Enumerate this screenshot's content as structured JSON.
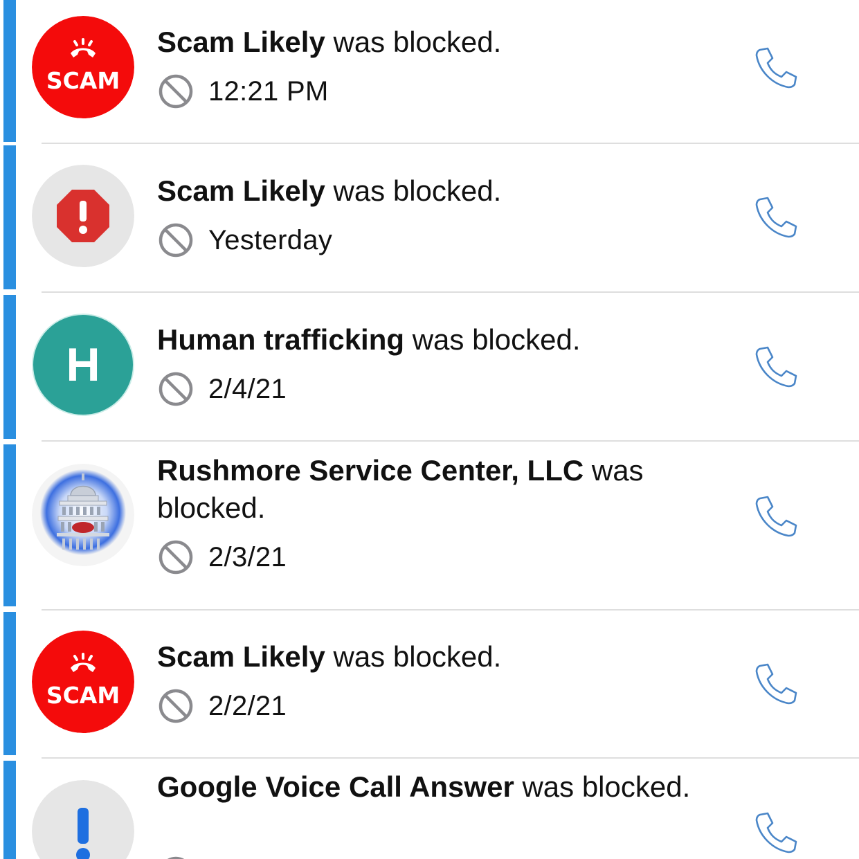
{
  "colors": {
    "accent_bar": "#2a8fe0",
    "scam_red": "#f40b0b",
    "warning_red": "#d9312e",
    "avatar_gray": "#e6e6e6",
    "avatar_teal": "#2ba197",
    "exclaim_blue": "#1e6fe0",
    "phone_blue": "#4a86c8",
    "block_gray": "#8a8a8e"
  },
  "icons": {
    "block": "prohibited-circle-icon",
    "call": "phone-handset-icon"
  },
  "items": [
    {
      "avatar_type": "scam-badge",
      "avatar_text": "SCAM",
      "name": "Scam Likely",
      "suffix": " was blocked.",
      "when": "12:21 PM"
    },
    {
      "avatar_type": "warning-octagon",
      "name": "Scam Likely",
      "suffix": " was blocked.",
      "when": "Yesterday"
    },
    {
      "avatar_type": "letter",
      "avatar_text": "H",
      "name": "Human trafficking",
      "suffix": " was blocked.",
      "when": "2/4/21"
    },
    {
      "avatar_type": "capitol-building",
      "name": "Rushmore Service Center, LLC",
      "suffix": " was blocked.",
      "when": "2/3/21"
    },
    {
      "avatar_type": "scam-badge",
      "avatar_text": "SCAM",
      "name": "Scam Likely",
      "suffix": " was blocked.",
      "when": "2/2/21"
    },
    {
      "avatar_type": "exclamation",
      "name": "Google Voice Call Answer",
      "suffix": " was blocked.",
      "when": ""
    }
  ]
}
